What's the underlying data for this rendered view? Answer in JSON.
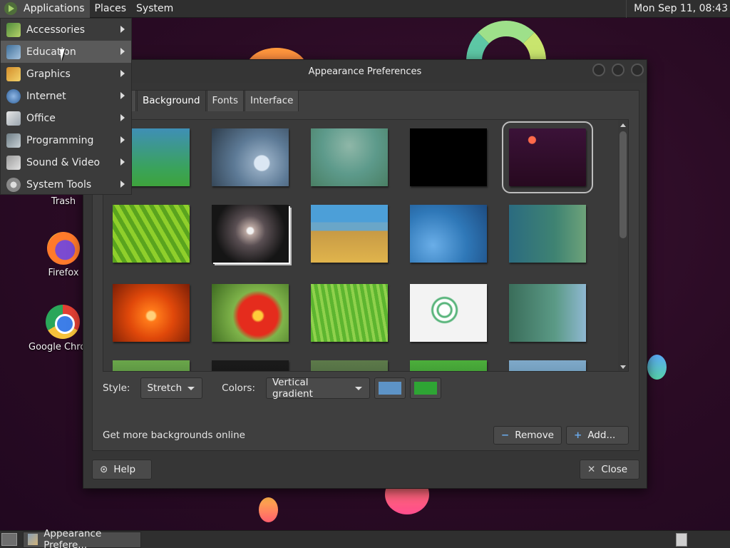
{
  "top_panel": {
    "applications": "Applications",
    "places": "Places",
    "system": "System",
    "clock": "Mon Sep 11, 08:43"
  },
  "app_menu": {
    "items": [
      {
        "label": "Accessories",
        "icon": "accessories-icon"
      },
      {
        "label": "Education",
        "icon": "education-icon"
      },
      {
        "label": "Graphics",
        "icon": "graphics-icon"
      },
      {
        "label": "Internet",
        "icon": "internet-icon"
      },
      {
        "label": "Office",
        "icon": "office-icon"
      },
      {
        "label": "Programming",
        "icon": "programming-icon"
      },
      {
        "label": "Sound & Video",
        "icon": "sound-video-icon"
      },
      {
        "label": "System Tools",
        "icon": "system-tools-icon"
      }
    ],
    "active_index": 1
  },
  "desktop_icons": {
    "trash": "Trash",
    "firefox": "Firefox",
    "chrome": "Google Chro"
  },
  "dialog": {
    "title": "Appearance Preferences",
    "tabs": [
      "",
      "Background",
      "Fonts",
      "Interface"
    ],
    "active_tab": 1,
    "style_label": "Style:",
    "style_value": "Stretch",
    "colors_label": "Colors:",
    "colors_value": "Vertical gradient",
    "primary_color": "#5d93c6",
    "secondary_color": "#2ea534",
    "online_link": "Get more backgrounds online",
    "remove_label": "Remove",
    "add_label": "Add...",
    "help_label": "Help",
    "close_label": "Close",
    "selected_wallpaper_index": 4,
    "wallpapers": [
      {
        "name": "wallpaper-blue-green-gradient"
      },
      {
        "name": "wallpaper-water-drop"
      },
      {
        "name": "wallpaper-soft-green-blur"
      },
      {
        "name": "wallpaper-arch-prism"
      },
      {
        "name": "wallpaper-purple-rocket"
      },
      {
        "name": "wallpaper-green-leaf"
      },
      {
        "name": "wallpaper-spiral-galaxy"
      },
      {
        "name": "wallpaper-wheat-field"
      },
      {
        "name": "wallpaper-blue-water"
      },
      {
        "name": "wallpaper-teal-bokeh"
      },
      {
        "name": "wallpaper-orange-flower"
      },
      {
        "name": "wallpaper-red-flower"
      },
      {
        "name": "wallpaper-green-grass"
      },
      {
        "name": "wallpaper-white-logo"
      },
      {
        "name": "wallpaper-teal-wave"
      },
      {
        "name": "wallpaper-partial-1"
      },
      {
        "name": "wallpaper-partial-2"
      },
      {
        "name": "wallpaper-partial-3"
      },
      {
        "name": "wallpaper-partial-4"
      },
      {
        "name": "wallpaper-partial-5"
      }
    ]
  },
  "taskbar": {
    "task_label": "Appearance Prefere..."
  }
}
